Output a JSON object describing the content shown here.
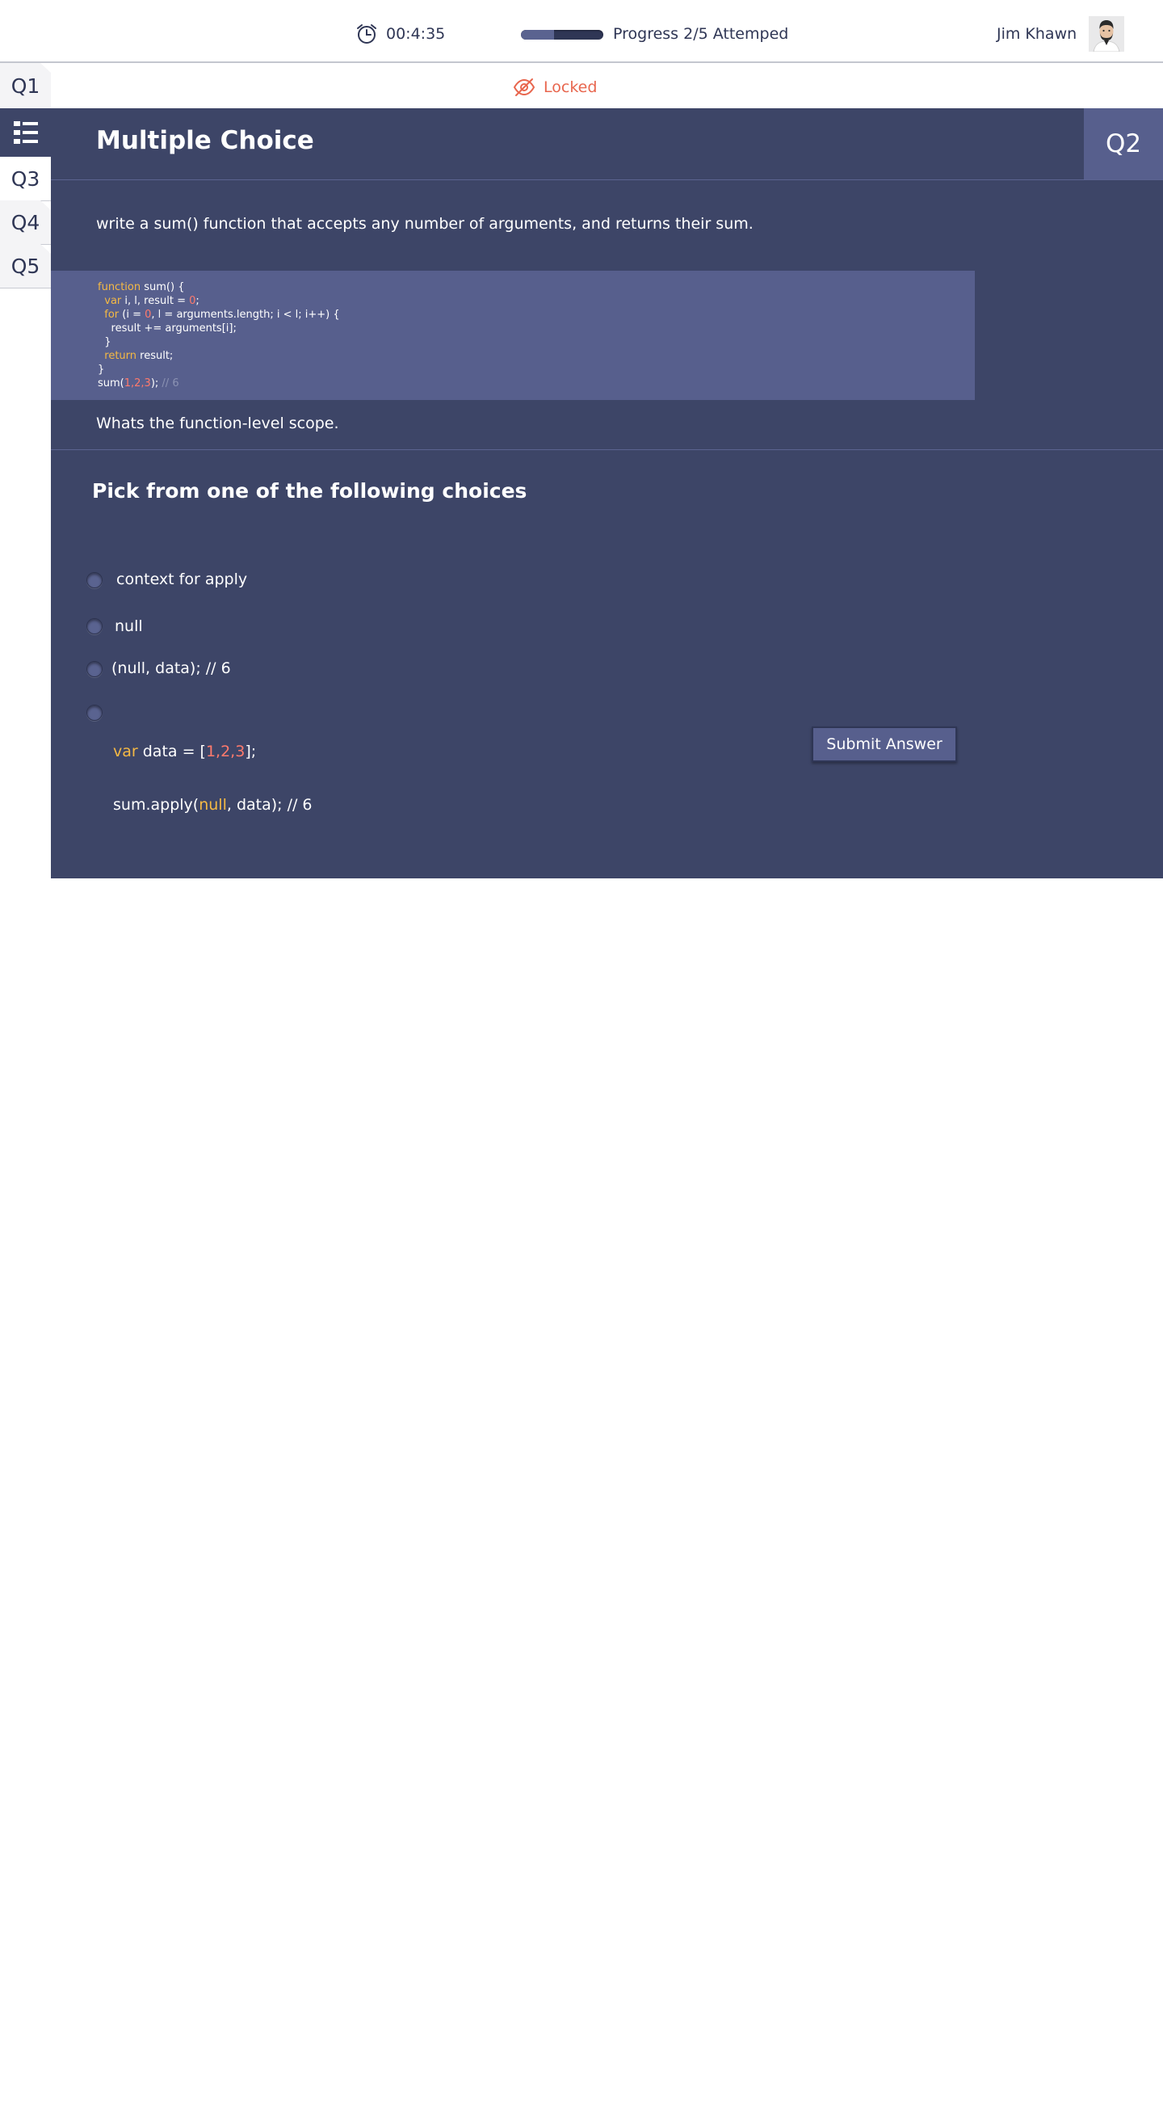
{
  "header": {
    "timer": "00:4:35",
    "progress_value": 0.4,
    "progress_text": "Progress 2/5 Attemped",
    "user_name": "Jim Khawn"
  },
  "nav": {
    "q1": "Q1",
    "q3": "Q3",
    "q4": "Q4",
    "q5": "Q5"
  },
  "locked_label": "Locked",
  "panel": {
    "title": "Multiple Choice",
    "badge": "Q2",
    "question": "write a sum() function that accepts any number of arguments, and returns their sum.",
    "code": {
      "l1_kw": "function",
      "l1_rest": " sum() {",
      "l2_kw": "  var",
      "l2_rest": " i, l, result = ",
      "l2_num": "0",
      "l2_end": ";",
      "l3_kw": "  for",
      "l3_a": " (i = ",
      "l3_num": "0",
      "l3_b": ", l = arguments.length; i < l; i++) {",
      "l4": "    result += arguments[i];",
      "l5": "  }",
      "l6_kw": "  return",
      "l6_rest": " result;",
      "l7": "}",
      "l8_a": "sum(",
      "l8_num": "1,2,3",
      "l8_b": "); ",
      "l8_cmt": "// 6"
    },
    "scope_text": "Whats the function-level scope.",
    "choices_title": "Pick from one of the following choices",
    "choices": {
      "c1": "context for apply",
      "c2": "null",
      "c3": "(null, data); // 6",
      "c4_kw": "var",
      "c4_a": " data = [",
      "c4_num": "1,2,3",
      "c4_b": "];",
      "c4_l2_a": "sum.apply(",
      "c4_l2_kw": "null",
      "c4_l2_b": ", data); // 6"
    },
    "submit_label": "Submit Answer"
  }
}
